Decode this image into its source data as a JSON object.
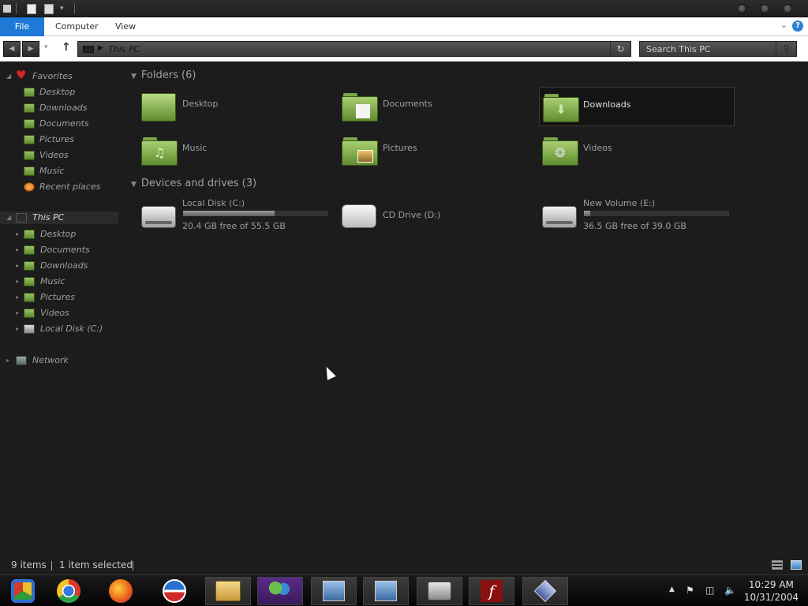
{
  "ribbon": {
    "tabs": [
      {
        "label": "File"
      },
      {
        "label": "Computer"
      },
      {
        "label": "View"
      }
    ],
    "help_label": "?"
  },
  "address": {
    "crumb": "This PC",
    "search_placeholder": "Search This PC"
  },
  "nav": {
    "favorites_label": "Favorites",
    "favorites": [
      "Desktop",
      "Downloads",
      "Documents",
      "Pictures",
      "Videos",
      "Music",
      "Recent places"
    ],
    "thispc_label": "This PC",
    "thispc": [
      "Desktop",
      "Documents",
      "Downloads",
      "Music",
      "Pictures",
      "Videos",
      "Local Disk (C:)"
    ],
    "network_label": "Network"
  },
  "content": {
    "folders_header": "Folders (6)",
    "folders": [
      "Desktop",
      "Documents",
      "Downloads",
      "Music",
      "Pictures",
      "Videos"
    ],
    "selected_folder": "Downloads",
    "devices_header": "Devices and drives (3)",
    "drives": [
      {
        "name": "Local Disk (C:)",
        "free": "20.4 GB free of 55.5 GB",
        "used_fraction": 0.63
      },
      {
        "name": "CD Drive (D:)"
      },
      {
        "name": "New Volume (E:)",
        "free": "36.5 GB free of 39.0 GB",
        "used_fraction": 0.06
      }
    ]
  },
  "status": {
    "items": "9 items",
    "selected": "1 item selected"
  },
  "taskbar": {
    "apps": [
      "chrome-canary-icon",
      "chrome-icon",
      "firefox-icon",
      "obama-logo-icon",
      "file-explorer-icon",
      "msn-messenger-icon",
      "network-setup-icon",
      "network-setup-icon-2",
      "printer-icon",
      "flash-icon",
      "diamond-app-icon"
    ],
    "time": "10:29 AM",
    "date": "10/31/2004"
  },
  "colors": {
    "accent": "#1e7ad6",
    "folder_green": "#7ea64b",
    "background": "#1c1c1c"
  }
}
